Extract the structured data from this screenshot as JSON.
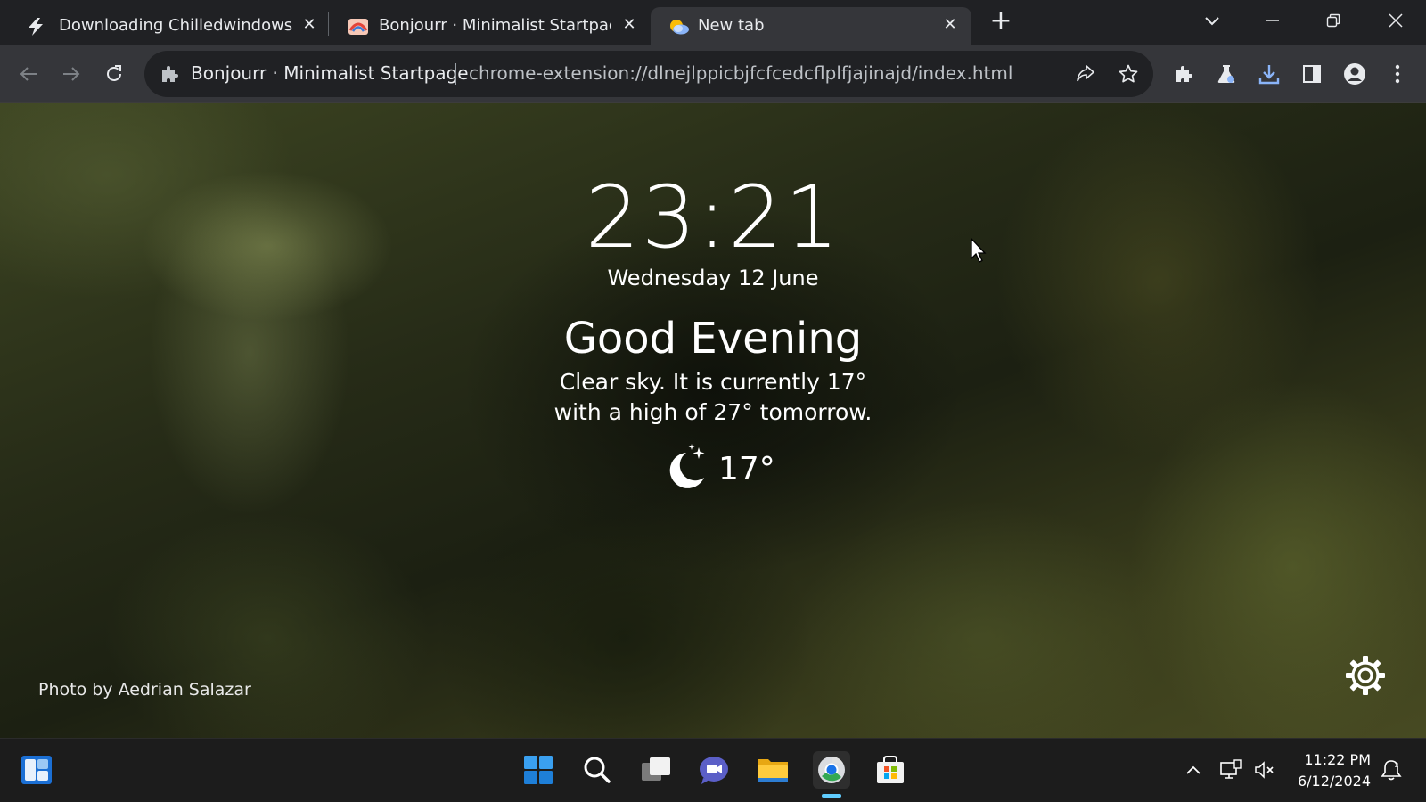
{
  "tabs": [
    {
      "title": "Downloading Chilledwindows.ex",
      "icon": "lightning-icon",
      "close": "✕"
    },
    {
      "title": "Bonjourr · Minimalist Startpage",
      "icon": "bonjourr-icon",
      "close": "✕"
    },
    {
      "title": "New tab",
      "icon": "weather-favicon",
      "close": "✕",
      "active": true
    }
  ],
  "new_tab_symbol": "+",
  "window_controls": {
    "tab_search": "⌄",
    "minimize": "—",
    "restore": "❐",
    "close": "✕"
  },
  "omnibox": {
    "site_title": "Bonjourr · Minimalist Startpage",
    "url": "chrome-extension://dlnejlppicbjfcfcedcflplfjajinajd/index.html"
  },
  "startpage": {
    "time": "23:21",
    "date": "Wednesday 12 June",
    "greeting": "Good Evening",
    "description_line1": "Clear sky. It is currently 17°",
    "description_line2": "with a high of 27° tomorrow.",
    "temperature": "17°",
    "weather_icon": "moon-stars-icon",
    "photo_credit": "Photo by Aedrian Salazar"
  },
  "taskbar": {
    "apps": [
      "widgets-icon",
      "windows-start-icon",
      "search-icon",
      "task-view-icon",
      "teams-chat-icon",
      "file-explorer-icon",
      "chrome-icon",
      "microsoft-store-icon"
    ],
    "time": "11:22 PM",
    "date": "6/12/2024"
  },
  "colors": {
    "tabstrip_bg": "#202124",
    "toolbar_bg": "#35363a",
    "omnibox_bg": "#202124",
    "taskbar_bg": "#1c1c1c",
    "accent_blue": "#8ab4f8",
    "taskbar_indicator": "#60cdff"
  }
}
